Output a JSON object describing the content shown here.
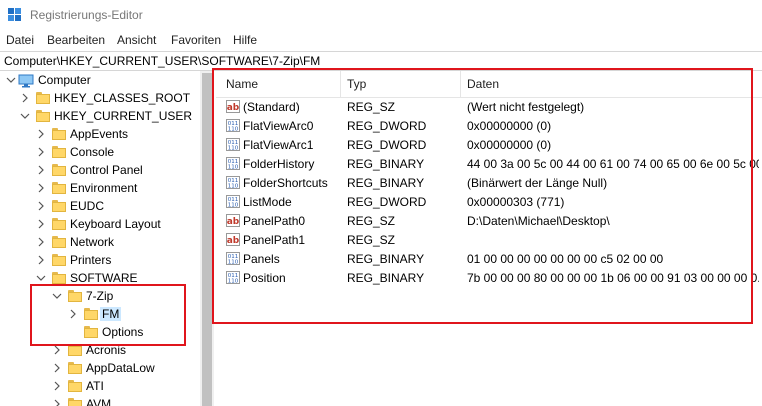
{
  "window": {
    "title": "Registrierungs-Editor"
  },
  "menu": [
    "Datei",
    "Bearbeiten",
    "Ansicht",
    "Favoriten",
    "Hilfe"
  ],
  "address": "Computer\\HKEY_CURRENT_USER\\SOFTWARE\\7-Zip\\FM",
  "tree": [
    {
      "label": "Computer",
      "level": 0,
      "expanded": true,
      "icon": "computer-icon"
    },
    {
      "label": "HKEY_CLASSES_ROOT",
      "level": 1,
      "expanded": false
    },
    {
      "label": "HKEY_CURRENT_USER",
      "level": 1,
      "expanded": true
    },
    {
      "label": "AppEvents",
      "level": 2,
      "expanded": false
    },
    {
      "label": "Console",
      "level": 2,
      "expanded": false
    },
    {
      "label": "Control Panel",
      "level": 2,
      "expanded": false
    },
    {
      "label": "Environment",
      "level": 2,
      "expanded": false
    },
    {
      "label": "EUDC",
      "level": 2,
      "expanded": false
    },
    {
      "label": "Keyboard Layout",
      "level": 2,
      "expanded": false
    },
    {
      "label": "Network",
      "level": 2,
      "expanded": false
    },
    {
      "label": "Printers",
      "level": 2,
      "expanded": false
    },
    {
      "label": "SOFTWARE",
      "level": 2,
      "expanded": true
    },
    {
      "label": "7-Zip",
      "level": 3,
      "expanded": true
    },
    {
      "label": "FM",
      "level": 4,
      "expanded": false,
      "selected": true
    },
    {
      "label": "Options",
      "level": 4,
      "expanded": null
    },
    {
      "label": "Acronis",
      "level": 3,
      "expanded": false
    },
    {
      "label": "AppDataLow",
      "level": 3,
      "expanded": false
    },
    {
      "label": "ATI",
      "level": 3,
      "expanded": false
    },
    {
      "label": "AVM",
      "level": 3,
      "expanded": false
    }
  ],
  "columns": {
    "name": "Name",
    "type": "Typ",
    "data": "Daten"
  },
  "values": [
    {
      "name": "(Standard)",
      "type": "REG_SZ",
      "data": "(Wert nicht festgelegt)",
      "icon": "string-value-icon"
    },
    {
      "name": "FlatViewArc0",
      "type": "REG_DWORD",
      "data": "0x00000000 (0)",
      "icon": "binary-value-icon"
    },
    {
      "name": "FlatViewArc1",
      "type": "REG_DWORD",
      "data": "0x00000000 (0)",
      "icon": "binary-value-icon"
    },
    {
      "name": "FolderHistory",
      "type": "REG_BINARY",
      "data": "44 00 3a 00 5c 00 44 00 61 00 74 00 65 00 6e 00 5c 00...",
      "icon": "binary-value-icon"
    },
    {
      "name": "FolderShortcuts",
      "type": "REG_BINARY",
      "data": "(Binärwert der Länge Null)",
      "icon": "binary-value-icon"
    },
    {
      "name": "ListMode",
      "type": "REG_DWORD",
      "data": "0x00000303 (771)",
      "icon": "binary-value-icon"
    },
    {
      "name": "PanelPath0",
      "type": "REG_SZ",
      "data": "D:\\Daten\\Michael\\Desktop\\",
      "icon": "string-value-icon"
    },
    {
      "name": "PanelPath1",
      "type": "REG_SZ",
      "data": "",
      "icon": "string-value-icon"
    },
    {
      "name": "Panels",
      "type": "REG_BINARY",
      "data": "01 00 00 00 00 00 00 00 c5 02 00 00",
      "icon": "binary-value-icon"
    },
    {
      "name": "Position",
      "type": "REG_BINARY",
      "data": "7b 00 00 00 80 00 00 00 1b 06 00 00 91 03 00 00 00 0...",
      "icon": "binary-value-icon"
    }
  ],
  "colors": {
    "highlight": "#e0151c",
    "selection": "#cce8ff",
    "folder": "#ffd768"
  }
}
